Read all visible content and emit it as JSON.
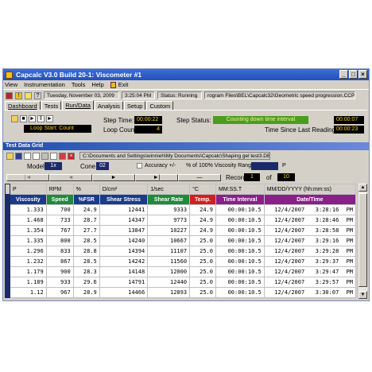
{
  "window": {
    "title": "Capcalc V3.0 Build 20-1: Viscometer #1"
  },
  "menu": [
    "View",
    "Instrumentation",
    "Tools",
    "Help",
    "Exit"
  ],
  "toolbar": {
    "date": "Tuesday, November 03, 2009",
    "time": "3:25:04 PM",
    "status": "Status: Running",
    "path": "rogram Files\\BEL\\Capcalc32\\Geometric speed progression.CCP"
  },
  "tabs": [
    "Dashboard",
    "Tests",
    "Run/Data",
    "Analysis",
    "Setup",
    "Custom"
  ],
  "run": {
    "loop_label": "Loop Start: Count",
    "step_time_label": "Step Time:",
    "step_time": "00:00:22",
    "loop_count_label": "Loop Count:",
    "loop_count": "4",
    "step_status_label": "Step Status:",
    "step_status": "Counting down time interval",
    "step_status_time": "00:00:07",
    "since_label": "Time Since Last Reading:",
    "since": "00:00:23"
  },
  "grid": {
    "title": "Test Data Grid",
    "file": "C:\\Documents and Settings\\winnieh\\My Documents\\Capcalc\\Shaping gel test3.DB",
    "model_label": "Model:",
    "model": "1x",
    "cone_label": "Cone:",
    "cone": "02",
    "accuracy_label": "Accuracy +/-",
    "range_label": "% of 100% Viscosity Range:",
    "range_unit": "P",
    "record_label": "Record",
    "record": "1",
    "of_label": "of",
    "total": "10",
    "nav": [
      "|◄",
      "◄",
      "►",
      "►|",
      "—"
    ]
  },
  "units": [
    "P",
    "RPM",
    "%",
    "D/cm²",
    "1/sec",
    "°C",
    "MM:SS.T",
    "MM/DD/YYYY (hh:mm:ss)"
  ],
  "headers": [
    "Viscosity",
    "Speed",
    "%FSR",
    "Shear Stress",
    "Shear Rate",
    "Temp.",
    "Time Interval",
    "Date/Time"
  ],
  "header_colors": [
    "#1a3a8a",
    "#1f8a3a",
    "#1a3a8a",
    "#1a3a8a",
    "#1f8a3a",
    "#d02020",
    "#8a1f8a",
    "#8a1f8a"
  ],
  "rows": [
    [
      "1.333",
      "700",
      "24.9",
      "12441",
      "9333",
      "24.9",
      "00:00:10.5",
      "12/4/2007",
      "3:28:16",
      "PM"
    ],
    [
      "1.468",
      "733",
      "28.7",
      "14347",
      "9773",
      "24.9",
      "00:00:10.5",
      "12/4/2007",
      "3:28:46",
      "PM"
    ],
    [
      "1.354",
      "767",
      "27.7",
      "13847",
      "10227",
      "24.9",
      "00:00:10.5",
      "12/4/2007",
      "3:28:58",
      "PM"
    ],
    [
      "1.335",
      "800",
      "28.5",
      "14240",
      "10667",
      "25.0",
      "00:00:10.5",
      "12/4/2007",
      "3:29:16",
      "PM"
    ],
    [
      "1.296",
      "833",
      "28.8",
      "14394",
      "11107",
      "25.0",
      "00:00:10.5",
      "12/4/2007",
      "3:29:28",
      "PM"
    ],
    [
      "1.232",
      "867",
      "28.5",
      "14242",
      "11560",
      "25.0",
      "00:00:10.5",
      "12/4/2007",
      "3:29:37",
      "PM"
    ],
    [
      "1.179",
      "900",
      "28.3",
      "14148",
      "12000",
      "25.0",
      "00:00:10.5",
      "12/4/2007",
      "3:29:47",
      "PM"
    ],
    [
      "1.189",
      "933",
      "29.6",
      "14791",
      "12440",
      "25.0",
      "00:00:10.5",
      "12/4/2007",
      "3:29:57",
      "PM"
    ],
    [
      "1.12",
      "967",
      "28.9",
      "14466",
      "12893",
      "25.0",
      "00:00:10.5",
      "12/4/2007",
      "3:30:07",
      "PM"
    ]
  ]
}
